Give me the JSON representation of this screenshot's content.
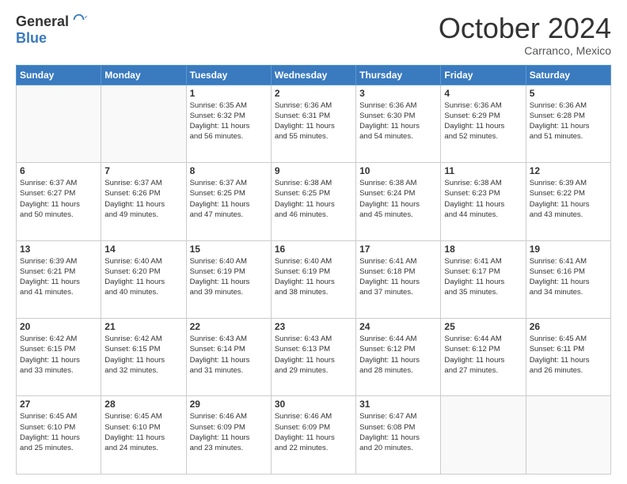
{
  "header": {
    "logo_general": "General",
    "logo_blue": "Blue",
    "month": "October 2024",
    "location": "Carranco, Mexico"
  },
  "weekdays": [
    "Sunday",
    "Monday",
    "Tuesday",
    "Wednesday",
    "Thursday",
    "Friday",
    "Saturday"
  ],
  "weeks": [
    [
      {
        "day": "",
        "info": ""
      },
      {
        "day": "",
        "info": ""
      },
      {
        "day": "1",
        "info": "Sunrise: 6:35 AM\nSunset: 6:32 PM\nDaylight: 11 hours\nand 56 minutes."
      },
      {
        "day": "2",
        "info": "Sunrise: 6:36 AM\nSunset: 6:31 PM\nDaylight: 11 hours\nand 55 minutes."
      },
      {
        "day": "3",
        "info": "Sunrise: 6:36 AM\nSunset: 6:30 PM\nDaylight: 11 hours\nand 54 minutes."
      },
      {
        "day": "4",
        "info": "Sunrise: 6:36 AM\nSunset: 6:29 PM\nDaylight: 11 hours\nand 52 minutes."
      },
      {
        "day": "5",
        "info": "Sunrise: 6:36 AM\nSunset: 6:28 PM\nDaylight: 11 hours\nand 51 minutes."
      }
    ],
    [
      {
        "day": "6",
        "info": "Sunrise: 6:37 AM\nSunset: 6:27 PM\nDaylight: 11 hours\nand 50 minutes."
      },
      {
        "day": "7",
        "info": "Sunrise: 6:37 AM\nSunset: 6:26 PM\nDaylight: 11 hours\nand 49 minutes."
      },
      {
        "day": "8",
        "info": "Sunrise: 6:37 AM\nSunset: 6:25 PM\nDaylight: 11 hours\nand 47 minutes."
      },
      {
        "day": "9",
        "info": "Sunrise: 6:38 AM\nSunset: 6:25 PM\nDaylight: 11 hours\nand 46 minutes."
      },
      {
        "day": "10",
        "info": "Sunrise: 6:38 AM\nSunset: 6:24 PM\nDaylight: 11 hours\nand 45 minutes."
      },
      {
        "day": "11",
        "info": "Sunrise: 6:38 AM\nSunset: 6:23 PM\nDaylight: 11 hours\nand 44 minutes."
      },
      {
        "day": "12",
        "info": "Sunrise: 6:39 AM\nSunset: 6:22 PM\nDaylight: 11 hours\nand 43 minutes."
      }
    ],
    [
      {
        "day": "13",
        "info": "Sunrise: 6:39 AM\nSunset: 6:21 PM\nDaylight: 11 hours\nand 41 minutes."
      },
      {
        "day": "14",
        "info": "Sunrise: 6:40 AM\nSunset: 6:20 PM\nDaylight: 11 hours\nand 40 minutes."
      },
      {
        "day": "15",
        "info": "Sunrise: 6:40 AM\nSunset: 6:19 PM\nDaylight: 11 hours\nand 39 minutes."
      },
      {
        "day": "16",
        "info": "Sunrise: 6:40 AM\nSunset: 6:19 PM\nDaylight: 11 hours\nand 38 minutes."
      },
      {
        "day": "17",
        "info": "Sunrise: 6:41 AM\nSunset: 6:18 PM\nDaylight: 11 hours\nand 37 minutes."
      },
      {
        "day": "18",
        "info": "Sunrise: 6:41 AM\nSunset: 6:17 PM\nDaylight: 11 hours\nand 35 minutes."
      },
      {
        "day": "19",
        "info": "Sunrise: 6:41 AM\nSunset: 6:16 PM\nDaylight: 11 hours\nand 34 minutes."
      }
    ],
    [
      {
        "day": "20",
        "info": "Sunrise: 6:42 AM\nSunset: 6:15 PM\nDaylight: 11 hours\nand 33 minutes."
      },
      {
        "day": "21",
        "info": "Sunrise: 6:42 AM\nSunset: 6:15 PM\nDaylight: 11 hours\nand 32 minutes."
      },
      {
        "day": "22",
        "info": "Sunrise: 6:43 AM\nSunset: 6:14 PM\nDaylight: 11 hours\nand 31 minutes."
      },
      {
        "day": "23",
        "info": "Sunrise: 6:43 AM\nSunset: 6:13 PM\nDaylight: 11 hours\nand 29 minutes."
      },
      {
        "day": "24",
        "info": "Sunrise: 6:44 AM\nSunset: 6:12 PM\nDaylight: 11 hours\nand 28 minutes."
      },
      {
        "day": "25",
        "info": "Sunrise: 6:44 AM\nSunset: 6:12 PM\nDaylight: 11 hours\nand 27 minutes."
      },
      {
        "day": "26",
        "info": "Sunrise: 6:45 AM\nSunset: 6:11 PM\nDaylight: 11 hours\nand 26 minutes."
      }
    ],
    [
      {
        "day": "27",
        "info": "Sunrise: 6:45 AM\nSunset: 6:10 PM\nDaylight: 11 hours\nand 25 minutes."
      },
      {
        "day": "28",
        "info": "Sunrise: 6:45 AM\nSunset: 6:10 PM\nDaylight: 11 hours\nand 24 minutes."
      },
      {
        "day": "29",
        "info": "Sunrise: 6:46 AM\nSunset: 6:09 PM\nDaylight: 11 hours\nand 23 minutes."
      },
      {
        "day": "30",
        "info": "Sunrise: 6:46 AM\nSunset: 6:09 PM\nDaylight: 11 hours\nand 22 minutes."
      },
      {
        "day": "31",
        "info": "Sunrise: 6:47 AM\nSunset: 6:08 PM\nDaylight: 11 hours\nand 20 minutes."
      },
      {
        "day": "",
        "info": ""
      },
      {
        "day": "",
        "info": ""
      }
    ]
  ]
}
